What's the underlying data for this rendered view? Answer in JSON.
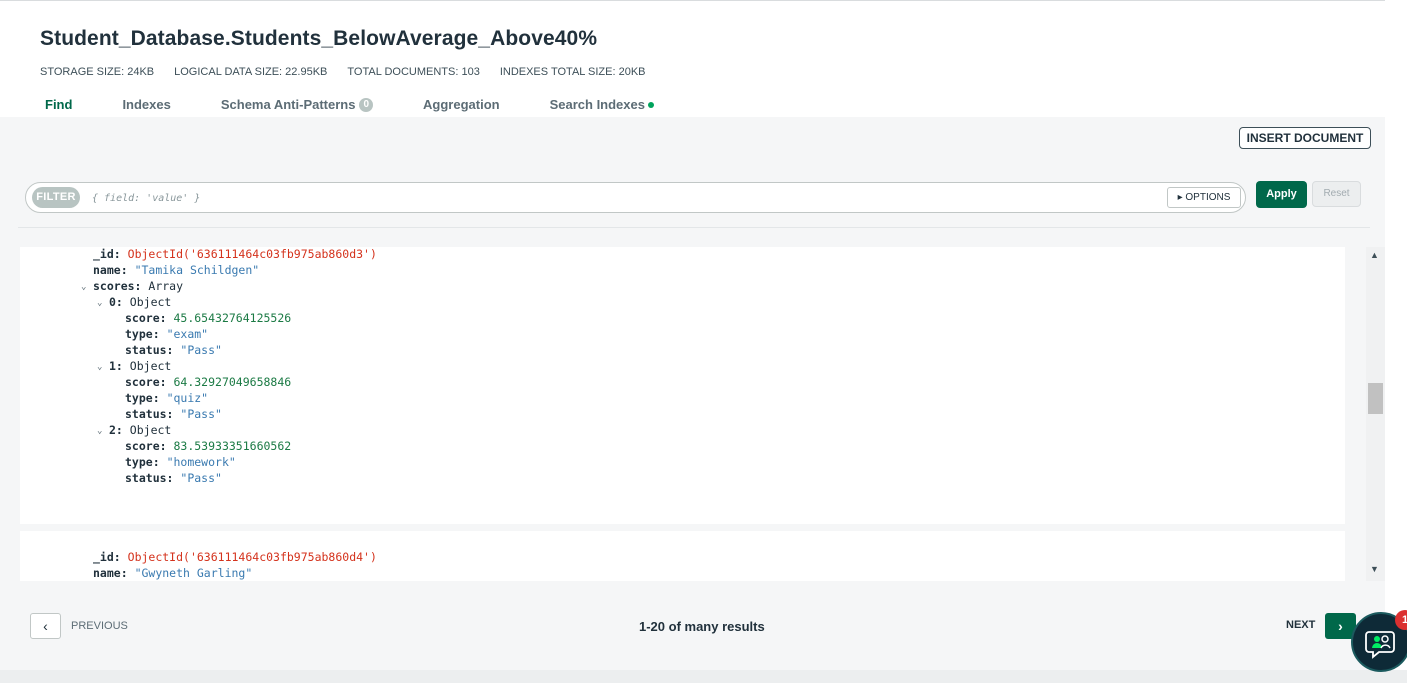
{
  "collection": {
    "title": "Student_Database.Students_BelowAverage_Above40%",
    "stats": {
      "storage_size": "STORAGE SIZE: 24KB",
      "logical_size": "LOGICAL DATA SIZE: 22.95KB",
      "total_documents": "TOTAL DOCUMENTS: 103",
      "indexes_size": "INDEXES TOTAL SIZE: 20KB"
    }
  },
  "tabs": [
    {
      "label": "Find",
      "active": true
    },
    {
      "label": "Indexes"
    },
    {
      "label": "Schema Anti-Patterns",
      "badge": "0"
    },
    {
      "label": "Aggregation"
    },
    {
      "label": "Search Indexes"
    }
  ],
  "toolbar": {
    "insert_label": "INSERT DOCUMENT",
    "filter_label": "FILTER",
    "filter_placeholder": "{ field: 'value' }",
    "options_label": "▸ OPTIONS",
    "apply_label": "Apply",
    "reset_label": "Reset"
  },
  "documents": [
    {
      "id_label": "_id:",
      "id_value": "ObjectId('636111464c03fb975ab860d3')",
      "name_label": "name:",
      "name_value": "\"Tamika Schildgen\"",
      "scores_label": "scores:",
      "scores_type": "Array",
      "scores": [
        {
          "index": "0:",
          "type_label": "Object",
          "score": "45.65432764125526",
          "type": "\"exam\"",
          "status": "\"Pass\""
        },
        {
          "index": "1:",
          "type_label": "Object",
          "score": "64.32927049658846",
          "type": "\"quiz\"",
          "status": "\"Pass\""
        },
        {
          "index": "2:",
          "type_label": "Object",
          "score": "83.53933351660562",
          "type": "\"homework\"",
          "status": "\"Pass\""
        }
      ]
    },
    {
      "id_label": "_id:",
      "id_value": "ObjectId('636111464c03fb975ab860d4')",
      "name_label": "name:",
      "name_value": "\"Gwyneth Garling\""
    }
  ],
  "field_labels": {
    "score": "score:",
    "type": "type:",
    "status": "status:"
  },
  "pagination": {
    "previous_label": "PREVIOUS",
    "results_text": "1-20 of many results",
    "next_label": "NEXT"
  },
  "chat": {
    "badge_count": "1"
  },
  "colors": {
    "accent": "#00684a",
    "string": "#3a7ab0",
    "number": "#1b7a44",
    "objectid": "#d4321c"
  }
}
